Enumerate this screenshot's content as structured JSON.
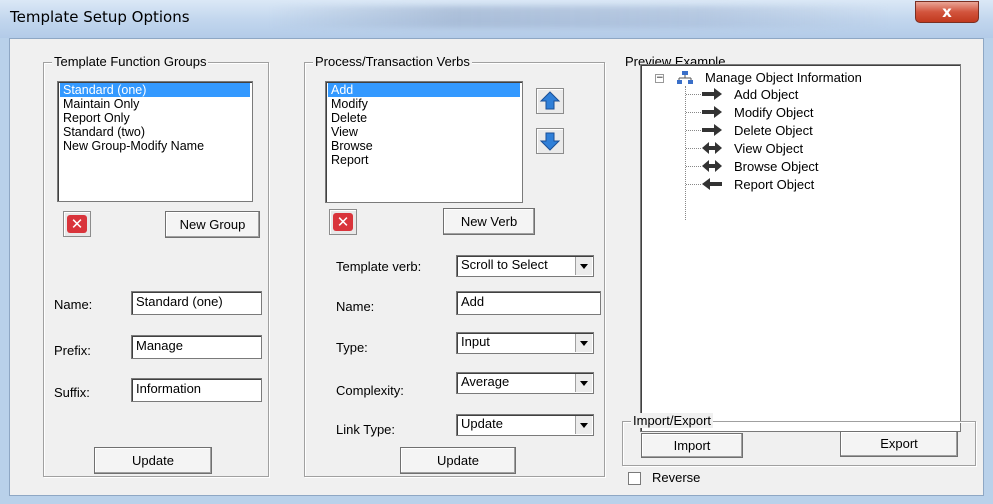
{
  "window": {
    "title": "Template Setup Options",
    "close_label": "x"
  },
  "function_groups": {
    "legend": "Template  Function Groups",
    "items": [
      {
        "label": "Standard  (one)",
        "selected": true
      },
      {
        "label": "Maintain Only",
        "selected": false
      },
      {
        "label": "Report Only",
        "selected": false
      },
      {
        "label": "Standard (two)",
        "selected": false
      },
      {
        "label": "New Group-Modify Name",
        "selected": false
      }
    ],
    "delete_icon": "red-x-icon",
    "new_group_label": "New Group",
    "name_label": "Name:",
    "name_value": "Standard  (one)",
    "prefix_label": "Prefix:",
    "prefix_value": "Manage",
    "suffix_label": "Suffix:",
    "suffix_value": "Information",
    "update_label": "Update"
  },
  "verbs": {
    "legend": "Process/Transaction Verbs",
    "items": [
      {
        "label": "Add",
        "selected": true
      },
      {
        "label": "Modify",
        "selected": false
      },
      {
        "label": "Delete",
        "selected": false
      },
      {
        "label": "View",
        "selected": false
      },
      {
        "label": "Browse",
        "selected": false
      },
      {
        "label": "Report",
        "selected": false
      }
    ],
    "delete_icon": "red-x-icon",
    "move_up_icon": "blue-arrow-up-icon",
    "move_down_icon": "blue-arrow-down-icon",
    "new_verb_label": "New Verb",
    "template_verb_label": "Template verb:",
    "template_verb_value": "Scroll to Select",
    "name_label": "Name:",
    "name_value": "Add",
    "type_label": "Type:",
    "type_value": "Input",
    "complexity_label": "Complexity:",
    "complexity_value": "Average",
    "link_type_label": "Link Type:",
    "link_type_value": "Update",
    "update_label": "Update"
  },
  "preview": {
    "legend": "Preview Example",
    "root": {
      "label": "Manage Object Information",
      "icon": "hierarchy-icon",
      "expander": "−"
    },
    "children": [
      {
        "label": "Add Object",
        "icon": "arrow-right-icon"
      },
      {
        "label": "Modify Object",
        "icon": "arrow-right-icon"
      },
      {
        "label": "Delete Object",
        "icon": "arrow-right-icon"
      },
      {
        "label": "View Object",
        "icon": "arrow-both-icon"
      },
      {
        "label": "Browse Object",
        "icon": "arrow-both-icon"
      },
      {
        "label": "Report Object",
        "icon": "arrow-left-icon"
      }
    ]
  },
  "import_export": {
    "legend": "Import/Export",
    "import_label": "Import",
    "export_label": "Export"
  },
  "reverse": {
    "label": "Reverse",
    "checked": false
  },
  "colors": {
    "selection": "#3399ff",
    "delete_red": "#d9343b",
    "arrow_blue": "#2f7fd8"
  }
}
